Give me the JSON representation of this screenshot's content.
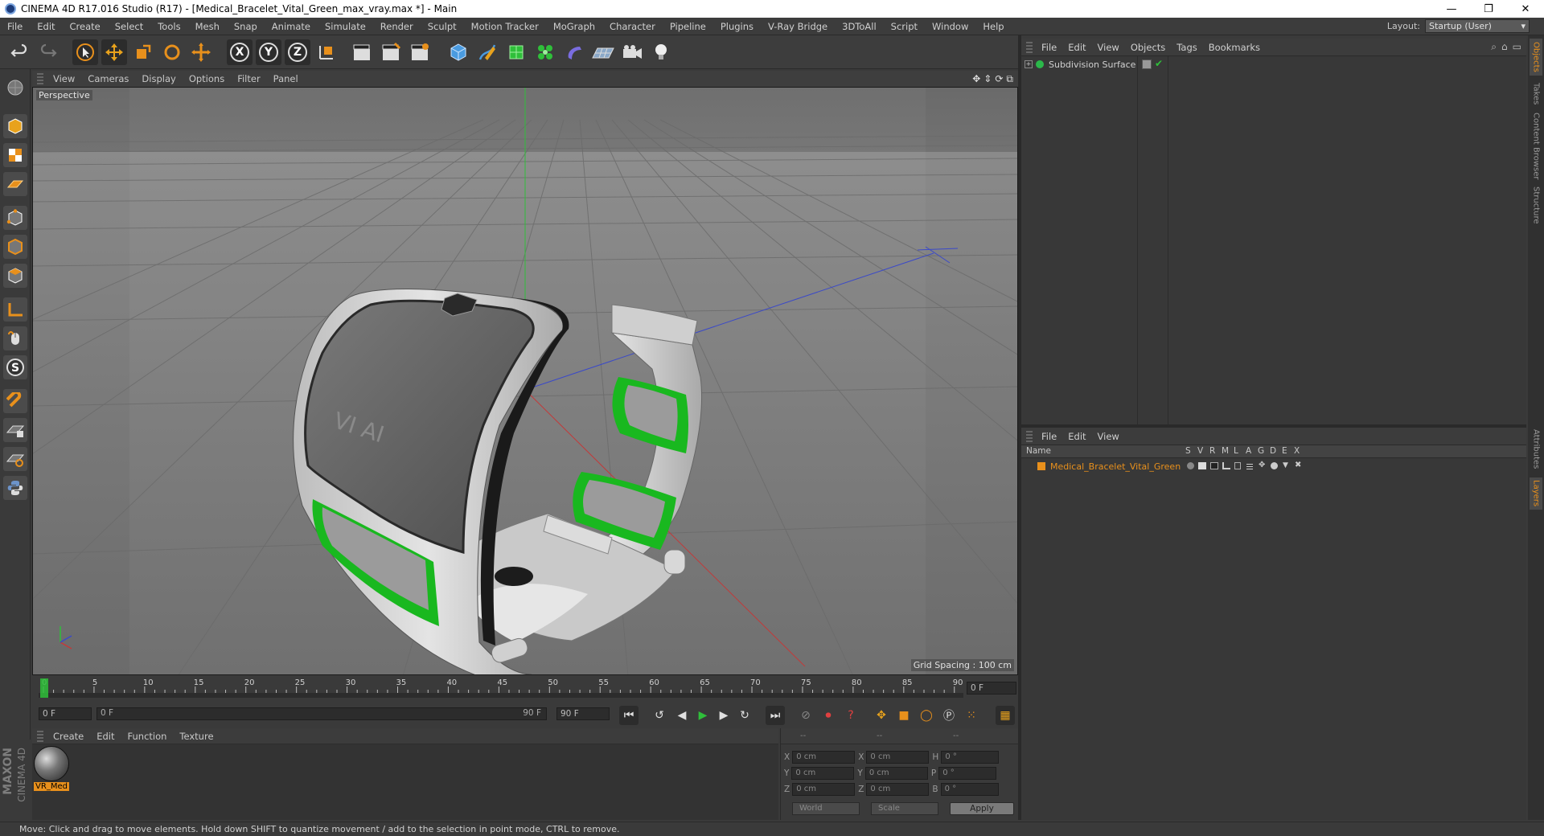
{
  "window": {
    "title": "CINEMA 4D R17.016 Studio (R17) - [Medical_Bracelet_Vital_Green_max_vray.max *] - Main",
    "minimize": "—",
    "restore": "❐",
    "close": "✕"
  },
  "menubar": {
    "items": [
      "File",
      "Edit",
      "Create",
      "Select",
      "Tools",
      "Mesh",
      "Snap",
      "Animate",
      "Simulate",
      "Render",
      "Sculpt",
      "Motion Tracker",
      "MoGraph",
      "Character",
      "Pipeline",
      "Plugins",
      "V-Ray Bridge",
      "3DToAll",
      "Script",
      "Window",
      "Help"
    ],
    "layout_label": "Layout:",
    "layout_value": "Startup (User)"
  },
  "toolbar": {
    "axis_x": "X",
    "axis_y": "Y",
    "axis_z": "Z"
  },
  "viewport": {
    "menu": [
      "View",
      "Cameras",
      "Display",
      "Options",
      "Filter",
      "Panel"
    ],
    "label": "Perspective",
    "grid_spacing": "Grid Spacing : 100 cm",
    "model_logo": "VI AI"
  },
  "timeline": {
    "ticks": [
      "0",
      "5",
      "10",
      "15",
      "20",
      "25",
      "30",
      "35",
      "40",
      "45",
      "50",
      "55",
      "60",
      "65",
      "70",
      "75",
      "80",
      "85",
      "90"
    ],
    "current_frame": "0 F"
  },
  "frames": {
    "start": "0 F",
    "range_start": "0 F",
    "range_end": "90 F",
    "end": "90 F"
  },
  "materials": {
    "menu": [
      "Create",
      "Edit",
      "Function",
      "Texture"
    ],
    "items": [
      {
        "name": "VR_Med"
      }
    ]
  },
  "branding": {
    "maxon": "MAXON",
    "c4d": "CINEMA 4D"
  },
  "coordinates": {
    "header": [
      "--",
      "--",
      "--"
    ],
    "rows": [
      {
        "a": "X",
        "v1": "0 cm",
        "b": "X",
        "v2": "0 cm",
        "c": "H",
        "v3": "0 °"
      },
      {
        "a": "Y",
        "v1": "0 cm",
        "b": "Y",
        "v2": "0 cm",
        "c": "P",
        "v3": "0 °"
      },
      {
        "a": "Z",
        "v1": "0 cm",
        "b": "Z",
        "v2": "0 cm",
        "c": "B",
        "v3": "0 °"
      }
    ],
    "world": "World",
    "scale": "Scale",
    "apply": "Apply"
  },
  "objects_panel": {
    "menu": [
      "File",
      "Edit",
      "View",
      "Objects",
      "Tags",
      "Bookmarks"
    ],
    "items": [
      {
        "name": "Subdivision Surface",
        "color": "#2bb84a"
      }
    ]
  },
  "layers_panel": {
    "menu": [
      "File",
      "Edit",
      "View"
    ],
    "columns": [
      "Name",
      "S",
      "V",
      "R",
      "M",
      "L",
      "A",
      "G",
      "D",
      "E",
      "X"
    ],
    "items": [
      {
        "name": "Medical_Bracelet_Vital_Green",
        "color": "#e8901c"
      }
    ]
  },
  "side_tabs": [
    "Objects",
    "Takes",
    "Content Browser",
    "Structure",
    "Attributes",
    "Layers"
  ],
  "status": "Move: Click and drag to move elements. Hold down SHIFT to quantize movement / add to the selection in point mode, CTRL to remove.",
  "colors": {
    "accent_orange": "#e8901c",
    "green": "#2fbf3a",
    "bracelet_green": "#19b81f",
    "active_blue": "#6c93c9"
  }
}
